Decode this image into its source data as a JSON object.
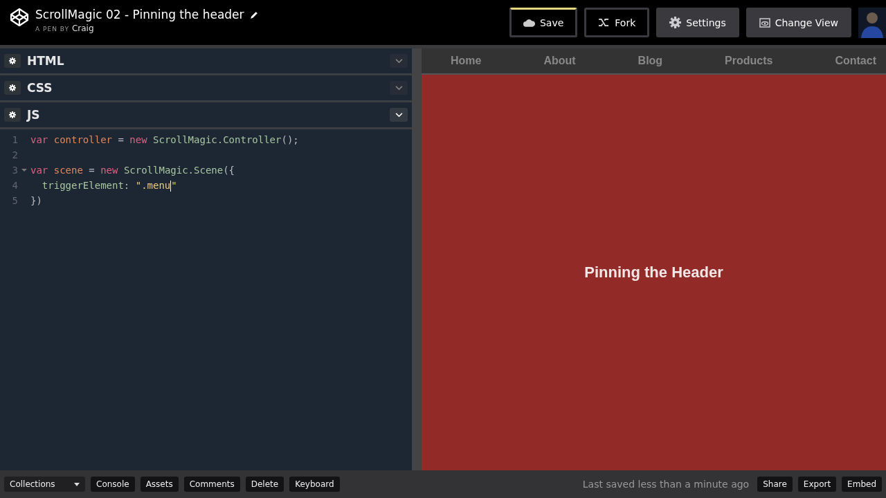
{
  "header": {
    "title": "ScrollMagic 02 - Pinning the header",
    "byline": "A PEN BY",
    "author": "Craig",
    "buttons": [
      {
        "kind": "save",
        "label": "Save",
        "modified": true
      },
      {
        "kind": "fork",
        "label": "Fork",
        "modified": false
      },
      {
        "kind": "settings",
        "label": "Settings"
      },
      {
        "kind": "view",
        "label": "Change View"
      }
    ]
  },
  "editors": [
    {
      "title": "HTML",
      "expanded": false
    },
    {
      "title": "CSS",
      "expanded": false
    },
    {
      "title": "JS",
      "expanded": true
    }
  ],
  "code": [
    {
      "number": "1",
      "tokens": [
        {
          "kind": "keyword",
          "text": "var "
        },
        {
          "kind": "variable",
          "text": "controller"
        },
        {
          "kind": "operator",
          "text": " = "
        },
        {
          "kind": "keyword",
          "text": "new"
        },
        {
          "kind": "plain",
          "text": " ScrollMagic.Controller"
        },
        {
          "kind": "operator",
          "text": "();"
        }
      ]
    },
    {
      "number": "2"
    },
    {
      "number": "3",
      "foldable": true,
      "tokens": [
        {
          "kind": "keyword",
          "text": "var "
        },
        {
          "kind": "variable",
          "text": "scene"
        },
        {
          "kind": "operator",
          "text": " = "
        },
        {
          "kind": "keyword",
          "text": "new"
        },
        {
          "kind": "plain",
          "text": " ScrollMagic.Scene"
        },
        {
          "kind": "operator",
          "text": "({"
        }
      ]
    },
    {
      "number": "4",
      "tokens": [
        {
          "kind": "plain",
          "text": "  triggerElement: "
        },
        {
          "kind": "string",
          "text": "\".menu",
          "cursor": true
        },
        {
          "kind": "string",
          "text": "\""
        }
      ]
    },
    {
      "number": "5",
      "tokens": [
        {
          "kind": "operator",
          "text": "})"
        }
      ]
    }
  ],
  "preview": {
    "nav": [
      "Home",
      "About",
      "Blog",
      "Products",
      "Contact"
    ],
    "heading": "Pinning the Header"
  },
  "footer": {
    "collections": "Collections",
    "left_buttons": [
      "Console",
      "Assets",
      "Comments",
      "Delete",
      "Keyboard"
    ],
    "status": "Last saved less than a minute ago",
    "right_buttons": [
      "Share",
      "Export",
      "Embed"
    ]
  }
}
